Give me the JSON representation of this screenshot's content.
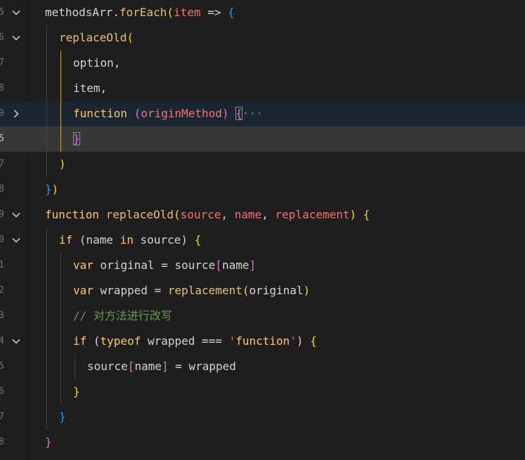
{
  "editor": {
    "line_numbers": [
      "5",
      "6",
      "7",
      "8",
      "9",
      "5",
      "7",
      "8",
      "9",
      "0",
      "1",
      "2",
      "3",
      "4",
      "5",
      "6",
      "7",
      "8"
    ],
    "lines": [
      {
        "tokens": [
          [
            "methodsArr",
            "t-plain"
          ],
          [
            ".",
            "t-plain"
          ],
          [
            "forEach",
            "t-fn-orange"
          ],
          [
            "(",
            "b-gold"
          ],
          [
            "item",
            "t-param"
          ],
          [
            " => ",
            "t-plain"
          ],
          [
            "{",
            "b-blue"
          ]
        ]
      },
      {
        "tokens": [
          [
            "replaceOld",
            "t-fn-orange"
          ],
          [
            "(",
            "b-gold"
          ]
        ]
      },
      {
        "tokens": [
          [
            "option",
            "t-plain"
          ],
          [
            ",",
            "t-plain"
          ]
        ]
      },
      {
        "tokens": [
          [
            "item",
            "t-plain"
          ],
          [
            ",",
            "t-plain"
          ]
        ]
      },
      {
        "tokens": [
          [
            "function",
            "t-kw-orange"
          ],
          [
            " ",
            "t-plain"
          ],
          [
            "(",
            "b-pink"
          ],
          [
            "originMethod",
            "t-param"
          ],
          [
            ")",
            "b-pink"
          ],
          [
            " ",
            "t-plain"
          ],
          [
            "{",
            "b-pink"
          ],
          [
            "···",
            "fold-ellipsis"
          ]
        ]
      },
      {
        "tokens": [
          [
            "}",
            "b-pink"
          ]
        ]
      },
      {
        "tokens": [
          [
            ")",
            "b-gold"
          ]
        ]
      },
      {
        "tokens": [
          [
            "}",
            "b-blue"
          ],
          [
            ")",
            "b-gold"
          ]
        ]
      },
      {
        "tokens": [
          [
            "function",
            "t-kw-orange"
          ],
          [
            " ",
            "t-plain"
          ],
          [
            "replaceOld",
            "t-fn-orange"
          ],
          [
            "(",
            "b-gold"
          ],
          [
            "source",
            "t-param"
          ],
          [
            ", ",
            "t-plain"
          ],
          [
            "name",
            "t-param"
          ],
          [
            ", ",
            "t-plain"
          ],
          [
            "replacement",
            "t-param"
          ],
          [
            ")",
            "b-gold"
          ],
          [
            " ",
            "t-plain"
          ],
          [
            "{",
            "b-gold"
          ]
        ]
      },
      {
        "tokens": [
          [
            "if",
            "t-kw-orange"
          ],
          [
            " (",
            "t-plain"
          ],
          [
            "name",
            "t-plain"
          ],
          [
            " ",
            "t-plain"
          ],
          [
            "in",
            "t-kw-orange"
          ],
          [
            " source",
            "t-plain"
          ],
          [
            ")",
            "t-plain"
          ],
          [
            " ",
            "t-plain"
          ],
          [
            "{",
            "b-gold"
          ]
        ]
      },
      {
        "tokens": [
          [
            "var",
            "t-kw-orange"
          ],
          [
            " original = ",
            "t-plain"
          ],
          [
            "source",
            "t-plain"
          ],
          [
            "[",
            "b-pink"
          ],
          [
            "name",
            "t-plain"
          ],
          [
            "]",
            "b-pink"
          ]
        ]
      },
      {
        "tokens": [
          [
            "var",
            "t-kw-orange"
          ],
          [
            " wrapped = ",
            "t-plain"
          ],
          [
            "replacement",
            "t-fn-orange"
          ],
          [
            "(",
            "b-gold"
          ],
          [
            "original",
            "t-plain"
          ],
          [
            ")",
            "b-gold"
          ]
        ]
      },
      {
        "tokens": [
          [
            "// 对方法进行改写",
            "t-comment"
          ]
        ]
      },
      {
        "tokens": [
          [
            "if",
            "t-kw-orange"
          ],
          [
            " (",
            "t-plain"
          ],
          [
            "typeof",
            "t-kw-orange"
          ],
          [
            " wrapped === ",
            "t-plain"
          ],
          [
            "'",
            "t-string"
          ],
          [
            "function",
            "t-kw-orange"
          ],
          [
            "'",
            "t-string"
          ],
          [
            ") ",
            "t-plain"
          ],
          [
            "{",
            "b-gold"
          ]
        ]
      },
      {
        "tokens": [
          [
            "source",
            "t-plain"
          ],
          [
            "[",
            "b-pink"
          ],
          [
            "name",
            "t-plain"
          ],
          [
            "]",
            "b-pink"
          ],
          [
            " = wrapped",
            "t-plain"
          ]
        ]
      },
      {
        "tokens": [
          [
            "}",
            "b-gold"
          ]
        ]
      },
      {
        "tokens": [
          [
            "}",
            "b-blue"
          ]
        ]
      },
      {
        "tokens": [
          [
            "}",
            "b-pink"
          ]
        ]
      }
    ],
    "indents": [
      0,
      1,
      2,
      2,
      2,
      2,
      1,
      0,
      0,
      1,
      2,
      2,
      2,
      2,
      3,
      2,
      1,
      0
    ],
    "fold_markers": [
      "open",
      "open",
      "none",
      "none",
      "collapsed",
      "none",
      "none",
      "none",
      "open",
      "open",
      "none",
      "none",
      "none",
      "open",
      "none",
      "none",
      "none",
      "none"
    ],
    "highlighted_line_blue": 4,
    "highlighted_line_gray": 5,
    "active_line_number": 5,
    "colors": {
      "background": "#1e1e1e",
      "keyword": "#ffc66d",
      "function": "#e5c07b",
      "param": "#ef7673",
      "comment": "#6a9955",
      "bracket_gold": "#ffd700",
      "bracket_pink": "#da70d6",
      "bracket_blue": "#179fff"
    },
    "icons": {
      "fold_open": "chevron-down-icon",
      "fold_collapsed": "chevron-right-icon"
    }
  }
}
